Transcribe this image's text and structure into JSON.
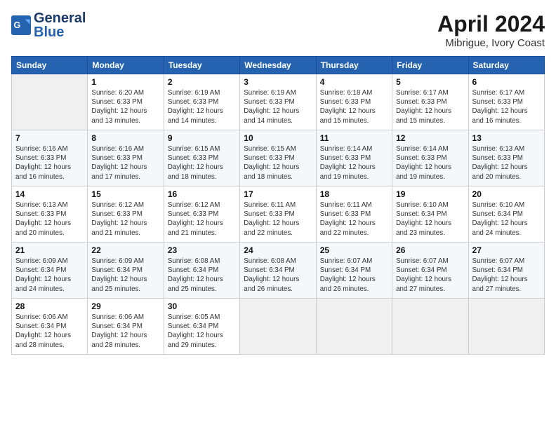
{
  "header": {
    "logo_general": "General",
    "logo_blue": "Blue",
    "title": "April 2024",
    "subtitle": "Mibrigue, Ivory Coast"
  },
  "days_of_week": [
    "Sunday",
    "Monday",
    "Tuesday",
    "Wednesday",
    "Thursday",
    "Friday",
    "Saturday"
  ],
  "weeks": [
    [
      {
        "num": "",
        "info": ""
      },
      {
        "num": "1",
        "info": "Sunrise: 6:20 AM\nSunset: 6:33 PM\nDaylight: 12 hours\nand 13 minutes."
      },
      {
        "num": "2",
        "info": "Sunrise: 6:19 AM\nSunset: 6:33 PM\nDaylight: 12 hours\nand 14 minutes."
      },
      {
        "num": "3",
        "info": "Sunrise: 6:19 AM\nSunset: 6:33 PM\nDaylight: 12 hours\nand 14 minutes."
      },
      {
        "num": "4",
        "info": "Sunrise: 6:18 AM\nSunset: 6:33 PM\nDaylight: 12 hours\nand 15 minutes."
      },
      {
        "num": "5",
        "info": "Sunrise: 6:17 AM\nSunset: 6:33 PM\nDaylight: 12 hours\nand 15 minutes."
      },
      {
        "num": "6",
        "info": "Sunrise: 6:17 AM\nSunset: 6:33 PM\nDaylight: 12 hours\nand 16 minutes."
      }
    ],
    [
      {
        "num": "7",
        "info": "Sunrise: 6:16 AM\nSunset: 6:33 PM\nDaylight: 12 hours\nand 16 minutes."
      },
      {
        "num": "8",
        "info": "Sunrise: 6:16 AM\nSunset: 6:33 PM\nDaylight: 12 hours\nand 17 minutes."
      },
      {
        "num": "9",
        "info": "Sunrise: 6:15 AM\nSunset: 6:33 PM\nDaylight: 12 hours\nand 18 minutes."
      },
      {
        "num": "10",
        "info": "Sunrise: 6:15 AM\nSunset: 6:33 PM\nDaylight: 12 hours\nand 18 minutes."
      },
      {
        "num": "11",
        "info": "Sunrise: 6:14 AM\nSunset: 6:33 PM\nDaylight: 12 hours\nand 19 minutes."
      },
      {
        "num": "12",
        "info": "Sunrise: 6:14 AM\nSunset: 6:33 PM\nDaylight: 12 hours\nand 19 minutes."
      },
      {
        "num": "13",
        "info": "Sunrise: 6:13 AM\nSunset: 6:33 PM\nDaylight: 12 hours\nand 20 minutes."
      }
    ],
    [
      {
        "num": "14",
        "info": "Sunrise: 6:13 AM\nSunset: 6:33 PM\nDaylight: 12 hours\nand 20 minutes."
      },
      {
        "num": "15",
        "info": "Sunrise: 6:12 AM\nSunset: 6:33 PM\nDaylight: 12 hours\nand 21 minutes."
      },
      {
        "num": "16",
        "info": "Sunrise: 6:12 AM\nSunset: 6:33 PM\nDaylight: 12 hours\nand 21 minutes."
      },
      {
        "num": "17",
        "info": "Sunrise: 6:11 AM\nSunset: 6:33 PM\nDaylight: 12 hours\nand 22 minutes."
      },
      {
        "num": "18",
        "info": "Sunrise: 6:11 AM\nSunset: 6:33 PM\nDaylight: 12 hours\nand 22 minutes."
      },
      {
        "num": "19",
        "info": "Sunrise: 6:10 AM\nSunset: 6:34 PM\nDaylight: 12 hours\nand 23 minutes."
      },
      {
        "num": "20",
        "info": "Sunrise: 6:10 AM\nSunset: 6:34 PM\nDaylight: 12 hours\nand 24 minutes."
      }
    ],
    [
      {
        "num": "21",
        "info": "Sunrise: 6:09 AM\nSunset: 6:34 PM\nDaylight: 12 hours\nand 24 minutes."
      },
      {
        "num": "22",
        "info": "Sunrise: 6:09 AM\nSunset: 6:34 PM\nDaylight: 12 hours\nand 25 minutes."
      },
      {
        "num": "23",
        "info": "Sunrise: 6:08 AM\nSunset: 6:34 PM\nDaylight: 12 hours\nand 25 minutes."
      },
      {
        "num": "24",
        "info": "Sunrise: 6:08 AM\nSunset: 6:34 PM\nDaylight: 12 hours\nand 26 minutes."
      },
      {
        "num": "25",
        "info": "Sunrise: 6:07 AM\nSunset: 6:34 PM\nDaylight: 12 hours\nand 26 minutes."
      },
      {
        "num": "26",
        "info": "Sunrise: 6:07 AM\nSunset: 6:34 PM\nDaylight: 12 hours\nand 27 minutes."
      },
      {
        "num": "27",
        "info": "Sunrise: 6:07 AM\nSunset: 6:34 PM\nDaylight: 12 hours\nand 27 minutes."
      }
    ],
    [
      {
        "num": "28",
        "info": "Sunrise: 6:06 AM\nSunset: 6:34 PM\nDaylight: 12 hours\nand 28 minutes."
      },
      {
        "num": "29",
        "info": "Sunrise: 6:06 AM\nSunset: 6:34 PM\nDaylight: 12 hours\nand 28 minutes."
      },
      {
        "num": "30",
        "info": "Sunrise: 6:05 AM\nSunset: 6:34 PM\nDaylight: 12 hours\nand 29 minutes."
      },
      {
        "num": "",
        "info": ""
      },
      {
        "num": "",
        "info": ""
      },
      {
        "num": "",
        "info": ""
      },
      {
        "num": "",
        "info": ""
      }
    ]
  ]
}
